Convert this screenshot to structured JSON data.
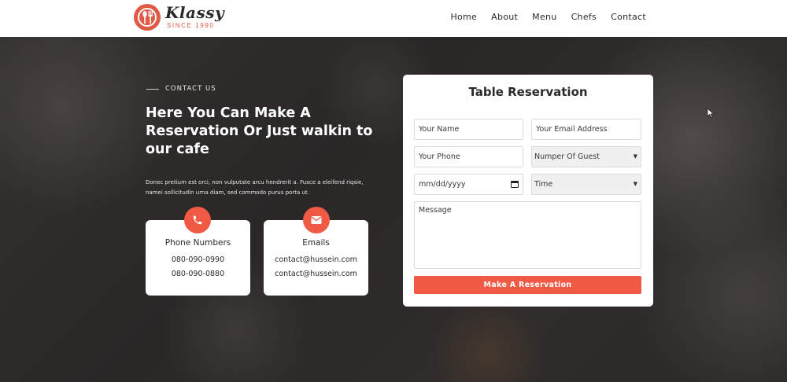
{
  "brand": {
    "name": "Klassy",
    "tagline": "SINCE 1990",
    "accent_color": "#f05a45"
  },
  "nav": {
    "items": [
      "Home",
      "About",
      "Menu",
      "Chefs",
      "Contact"
    ]
  },
  "contact": {
    "eyebrow": "CONTACT US",
    "headline": "Here You Can Make A Reservation Or Just walkin to our cafe",
    "description": "Donec pretium est orci, non vulputate arcu hendrerit a. Fusce a eleifend riqsie, namei sollicitudin urna diam, sed commodo purus porta ut.",
    "phone_card": {
      "icon": "phone-icon",
      "title": "Phone Numbers",
      "lines": [
        "080-090-0990",
        "080-090-0880"
      ]
    },
    "email_card": {
      "icon": "envelope-icon",
      "title": "Emails",
      "lines": [
        "contact@hussein.com",
        "contact@hussein.com"
      ]
    }
  },
  "form": {
    "title": "Table Reservation",
    "name_placeholder": "Your Name",
    "email_placeholder": "Your Email Address",
    "phone_placeholder": "Your Phone",
    "guests_selected": "Numper Of Guest",
    "date_placeholder": "mm/dd/yyyy",
    "time_selected": "Time",
    "message_placeholder": "Message",
    "submit_label": "Make A Reservation"
  }
}
